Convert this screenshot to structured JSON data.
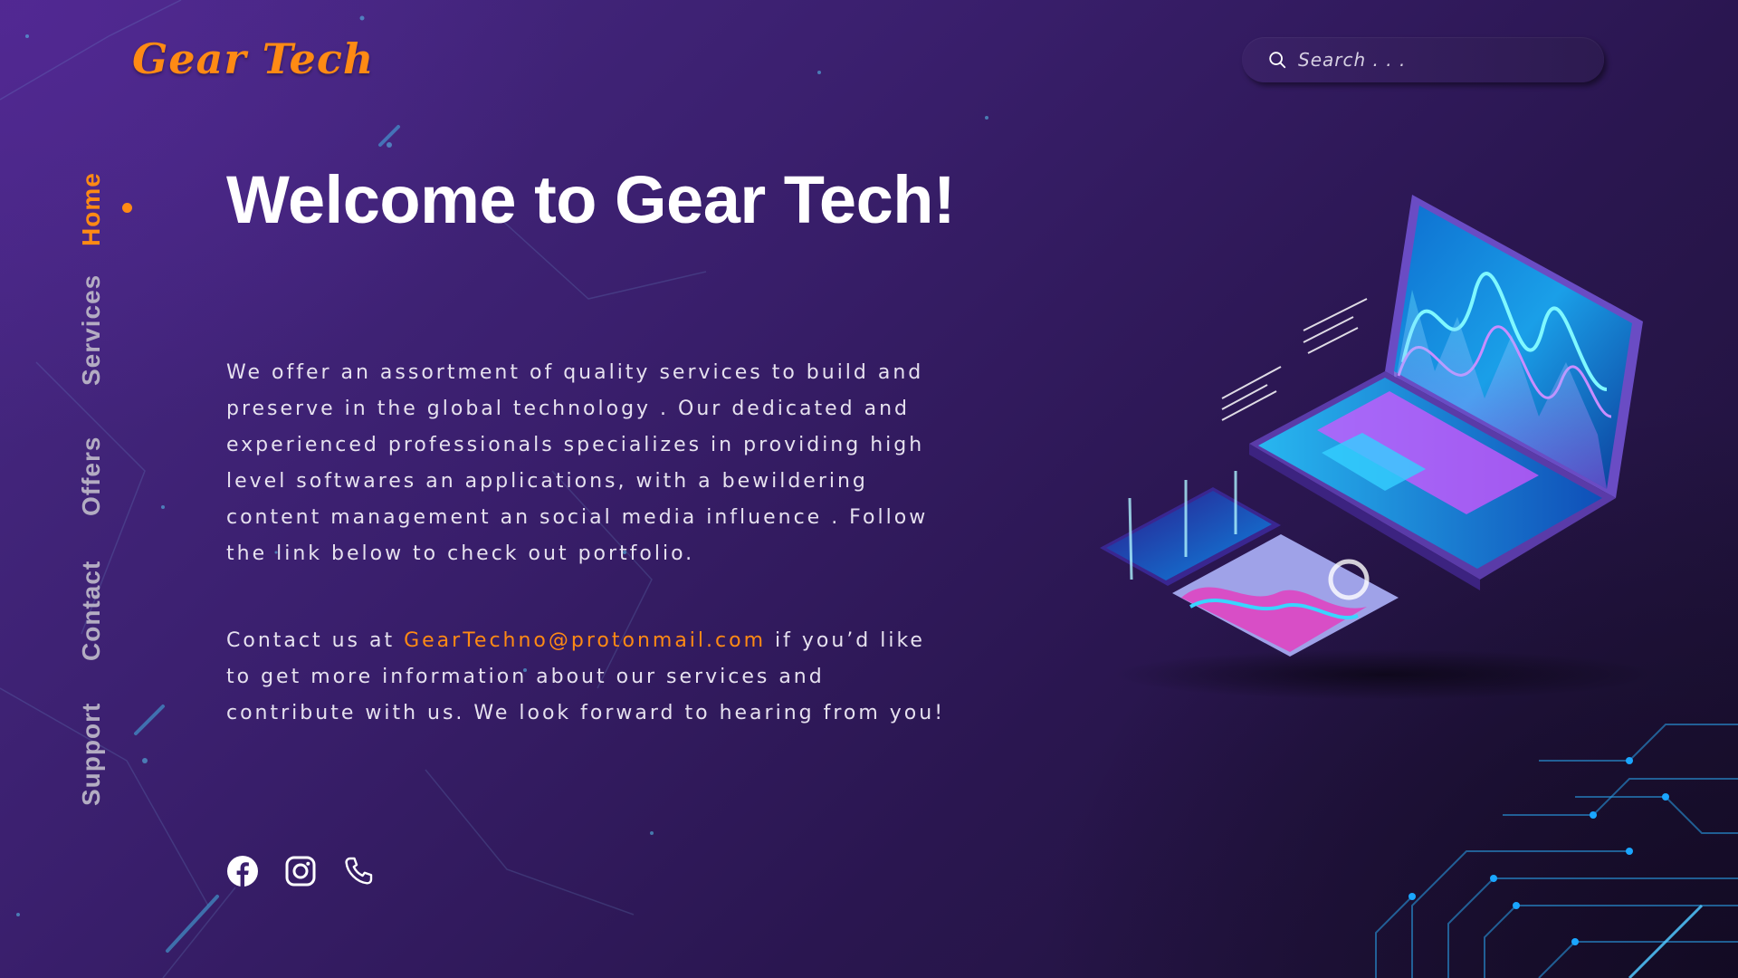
{
  "brand": {
    "logo_text": "Gear Tech"
  },
  "search": {
    "placeholder": "Search . . ."
  },
  "nav": {
    "items": [
      {
        "label": "Home",
        "active": true
      },
      {
        "label": "Services",
        "active": false
      },
      {
        "label": "Offers",
        "active": false
      },
      {
        "label": "Contact",
        "active": false
      },
      {
        "label": "Support",
        "active": false
      }
    ]
  },
  "main": {
    "headline": "Welcome to Gear Tech!",
    "intro": "We offer an assortment of quality services to build and preserve in the global technology . Our dedicated and experienced professionals specializes in providing high level softwares an applications, with a bewildering content management an social media influence . Follow the link below to check out portfolio.",
    "contact_prefix": "Contact us at ",
    "contact_email": "GearTechno@protonmail.com",
    "contact_suffix": " if you’d like to get more information about our services and contribute with us. We look forward to hearing from you!"
  },
  "social": {
    "icons": [
      "facebook-icon",
      "instagram-icon",
      "phone-icon"
    ]
  },
  "colors": {
    "accent": "#ff8a14",
    "background_top": "#4a2a88",
    "background_bottom": "#1c1232",
    "text": "#e6e1ef",
    "nav_inactive": "#b3acc2"
  }
}
